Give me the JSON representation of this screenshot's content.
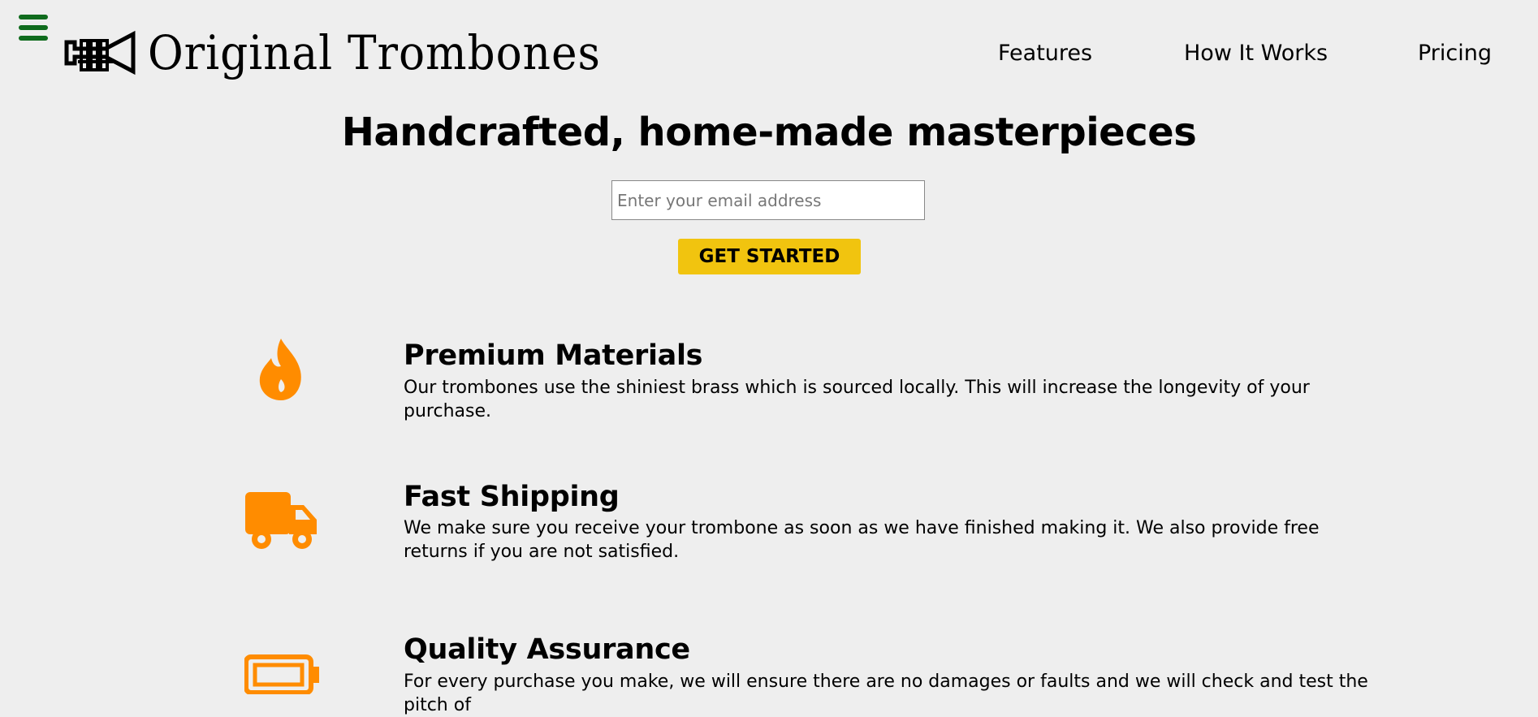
{
  "header": {
    "menu_icon": "hamburger-menu-icon",
    "logo_icon": "trumpet-icon",
    "logo_text": "Original Trombones",
    "nav": [
      "Features",
      "How It Works",
      "Pricing"
    ]
  },
  "hero": {
    "title": "Handcrafted, home-made masterpieces",
    "email_placeholder": "Enter your email address",
    "cta_label": "GET STARTED"
  },
  "features": [
    {
      "icon": "fire-icon",
      "title": "Premium Materials",
      "text": "Our trombones use the shiniest brass which is sourced locally. This will increase the longevity of your purchase."
    },
    {
      "icon": "truck-icon",
      "title": "Fast Shipping",
      "text": "We make sure you receive your trombone as soon as we have finished making it. We also provide free returns if you are not satisfied."
    },
    {
      "icon": "battery-full-icon",
      "title": "Quality Assurance",
      "text": "For every purchase you make, we will ensure there are no damages or faults and we will check and test the pitch of"
    }
  ],
  "colors": {
    "background": "#eeeeee",
    "accent_icon": "#ff8c00",
    "cta": "#f1c40f",
    "menu_icon": "#0f6b1d"
  }
}
